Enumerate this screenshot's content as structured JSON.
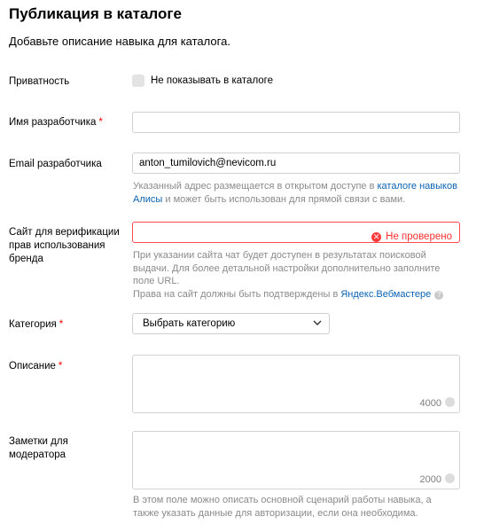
{
  "header": {
    "title": "Публикация в каталоге",
    "subtitle": "Добавьте описание навыка для каталога."
  },
  "privacy": {
    "label": "Приватность",
    "checkbox_label": "Не показывать в каталоге",
    "checked": false
  },
  "developer_name": {
    "label": "Имя разработчика",
    "required_mark": "*",
    "value": ""
  },
  "developer_email": {
    "label": "Email разработчика",
    "value": "anton_tumilovich@nevicom.ru",
    "hint_prefix": "Указанный адрес размещается в открытом доступе в ",
    "hint_link": "каталоге навыков Алисы",
    "hint_suffix": " и может быть использован для прямой связи с вами."
  },
  "site": {
    "label": "Сайт для верификации прав использования бренда",
    "value": "",
    "status": "Не проверено",
    "hint_line1": "При указании сайта чат будет доступен в результатах поисковой выдачи. Для более детальной настройки дополнительно заполните поле URL.",
    "hint_line2_prefix": "Права на сайт должны быть подтверждены в ",
    "hint_line2_link": "Яндекс.Вебмастере",
    "help_icon": "?"
  },
  "category": {
    "label": "Категория",
    "required_mark": "*",
    "selected": "Выбрать категорию"
  },
  "description": {
    "label": "Описание",
    "required_mark": "*",
    "value": "",
    "counter": "4000"
  },
  "moderator_notes": {
    "label": "Заметки для модератора",
    "value": "",
    "counter": "2000",
    "hint": "В этом поле можно описать основной сценарий работы навыка, а также указать данные для авторизации, если она необходима."
  },
  "colors": {
    "required": "#ff0000",
    "error": "#ff2f2f",
    "link": "#0b63b4",
    "hint": "#8a8a8a"
  },
  "icons": {
    "error": "error-circle-icon",
    "chevron": "chevron-down-icon",
    "help": "question-circle-icon"
  }
}
